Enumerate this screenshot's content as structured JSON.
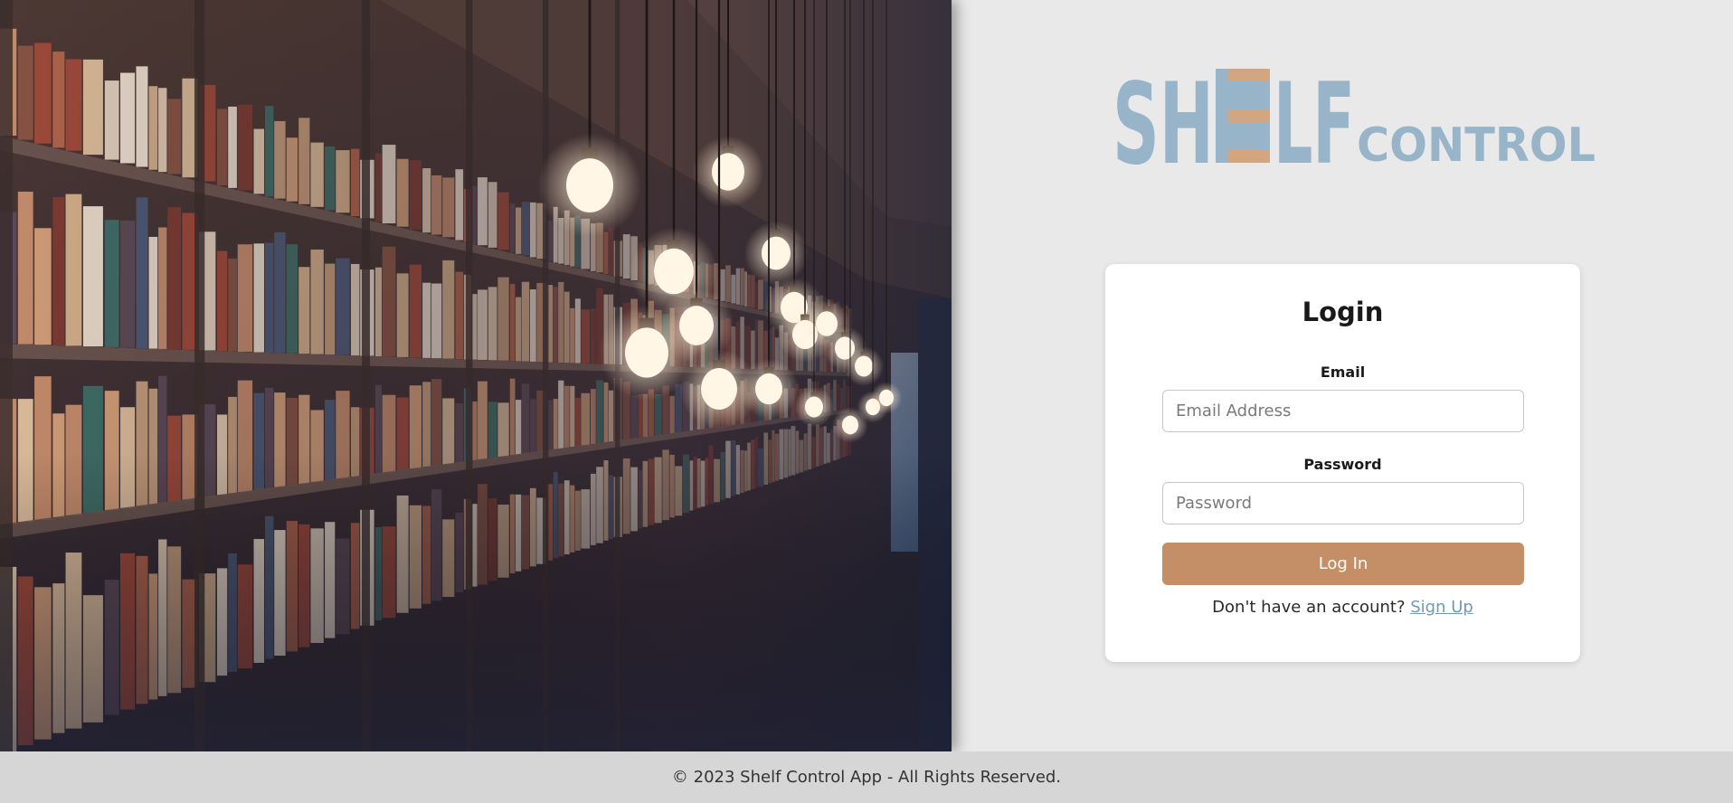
{
  "app": {
    "logo_part1": "SH",
    "logo_part2": "LF",
    "logo_part3": "CONTROL",
    "logo_color": "#97b4c8",
    "logo_accent_color": "#d3a680"
  },
  "background_image": {
    "icon": "library-bookshelves-with-hanging-bulbs-photo"
  },
  "login": {
    "title": "Login",
    "email_label": "Email",
    "email_placeholder": "Email Address",
    "email_value": "",
    "password_label": "Password",
    "password_placeholder": "Password",
    "password_value": "",
    "submit_label": "Log In",
    "submit_color": "#c48f66",
    "signup_prompt": "Don't have an account?",
    "signup_link": "Sign Up",
    "signup_link_color": "#6f9bb5"
  },
  "footer": {
    "text": "© 2023 Shelf Control App - All Rights Reserved."
  }
}
